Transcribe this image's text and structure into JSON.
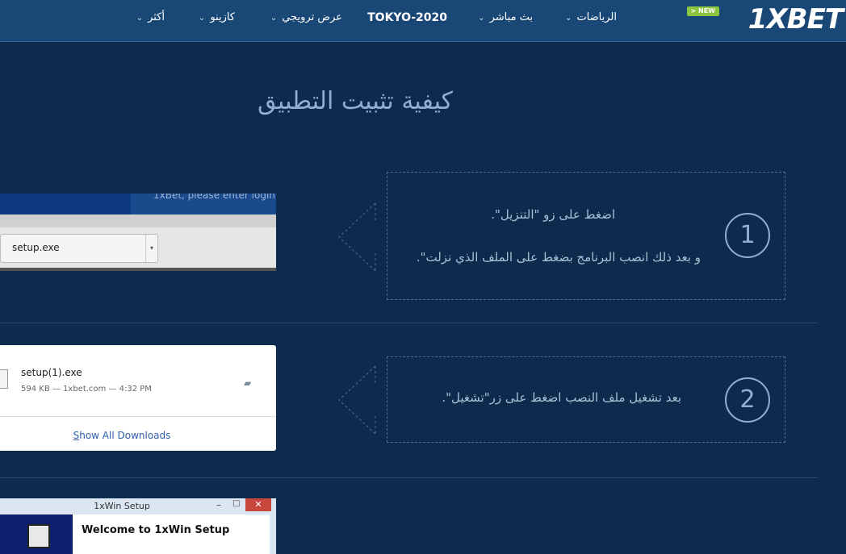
{
  "header": {
    "logo": "1XBET",
    "new_badge": "> NEW",
    "nav": [
      {
        "label": "الرياضات",
        "chevron": "⌄"
      },
      {
        "label": "بث مباشر",
        "chevron": "⌄"
      },
      {
        "label": "TOKYO-2020"
      },
      {
        "label": "عرض ترويجي",
        "chevron": "⌄"
      },
      {
        "label": "كازينو",
        "chevron": "⌄"
      },
      {
        "label": "أكثر",
        "chevron": "⌄"
      }
    ]
  },
  "page_title": "كيفية تثبيت التطبيق",
  "steps": [
    {
      "number": "1",
      "line1": "اضغط على زو \"التنزيل\".",
      "line2": "و بعد ذلك انصب البرنامج بضغط على الملف الذي نزلت\"."
    },
    {
      "number": "2",
      "line1": "بعد تشغيل ملف النصب اضغط على زر\"تشغيل\"."
    }
  ],
  "shot1": {
    "hint_text": "1xBet, please enter login",
    "file_name": "setup.exe"
  },
  "shot2": {
    "file_name": "setup(1).exe",
    "meta": "594 KB — 1xbet.com — 4:32 PM",
    "show_all_first": "S",
    "show_all_rest": "how All Downloads"
  },
  "shot3": {
    "window_title": "1xWin Setup",
    "welcome": "Welcome to 1xWin Setup",
    "close_glyph": "✕",
    "min_glyph": "–",
    "max_glyph": "□"
  },
  "colors": {
    "background": "#0d2b4c",
    "header": "#194876",
    "accent_text": "#8fb0cf",
    "new_badge": "#8cc63f"
  }
}
